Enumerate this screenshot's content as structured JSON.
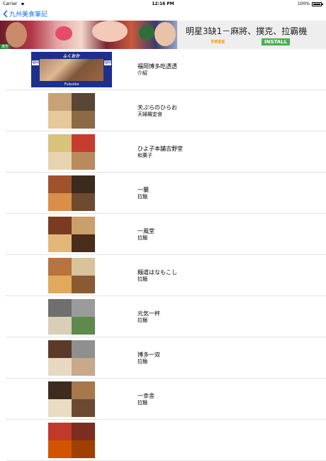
{
  "status_bar": {
    "carrier": "Carrier",
    "time": "12:16 PM",
    "battery": "100%"
  },
  "nav": {
    "back_label": "九州美食筆記"
  },
  "ad": {
    "title": "明星3缺1－麻將、撲克、拉霸機",
    "free": "FREE",
    "install": "INSTALL",
    "label": "廣告"
  },
  "list": {
    "items": [
      {
        "title": "福岡博多吃透透",
        "subtitle": "介紹",
        "banner": {
          "top": "ふくおか",
          "bottom": "Fukuoka",
          "left": "福岡",
          "right": "福岡"
        }
      },
      {
        "title": "天ぷらのひらお",
        "subtitle": "天婦羅定食"
      },
      {
        "title": "ひよ子本舗吉野堂",
        "subtitle": "和菓子"
      },
      {
        "title": "一蘭",
        "subtitle": "拉麵"
      },
      {
        "title": "一風堂",
        "subtitle": "拉麵"
      },
      {
        "title": "麺道はなもこし",
        "subtitle": "拉麵"
      },
      {
        "title": "元気一杯",
        "subtitle": "拉麵"
      },
      {
        "title": "博多一双",
        "subtitle": "拉麵"
      },
      {
        "title": "一幸舎",
        "subtitle": "拉麵"
      },
      {
        "title": "",
        "subtitle": ""
      }
    ]
  },
  "colors": {
    "accent": "#1a73e8",
    "install_bg": "#4caf50",
    "free": "#ff9800"
  }
}
